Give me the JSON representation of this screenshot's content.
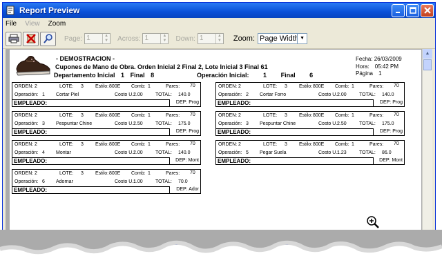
{
  "window": {
    "title": "Report Preview",
    "menu": [
      "File",
      "View",
      "Zoom"
    ]
  },
  "toolbar": {
    "page_label": "Page:",
    "page_value": "1",
    "across_label": "Across:",
    "across_value": "1",
    "down_label": "Down:",
    "down_value": "1",
    "zoom_label": "Zoom:",
    "zoom_value": "Page Width"
  },
  "report": {
    "title": "- DEMOSTRACION -",
    "line2": "Cupones de Mano de Obra.   Orden Inicial 2 Final 2, Lote Inicial 3 Final 61",
    "dept_label": "Departamento Inicial",
    "dept_from": "1",
    "dept_final_label": "Final",
    "dept_to": "8",
    "op_label": "Operación Inicial:",
    "op_from": "1",
    "op_final_label": "Final",
    "op_to": "6",
    "fecha_label": "Fecha:",
    "fecha_value": "26/03/2009",
    "hora_label": "Hora:",
    "hora_value": "05:42 PM",
    "pagina_label": "Página",
    "pagina_value": "1"
  },
  "labels": {
    "orden": "ORDEN:",
    "lote": "LOTE:",
    "estilo": "Estilo:",
    "comb": "Comb:",
    "pares": "Pares:",
    "operacion": "Operación:",
    "costo": "Costo U.:",
    "total": "TOTAL:",
    "empleado": "EMPLEADO:",
    "dep": "DEP:"
  },
  "cards": [
    {
      "orden": "2",
      "lote": "3",
      "estilo": "800E",
      "comb": "1",
      "pares": "70",
      "op": "1",
      "opname": "Cortar Piel",
      "costo": "2.00",
      "total": "140.0",
      "dep": "Prog"
    },
    {
      "orden": "2",
      "lote": "3",
      "estilo": "800E",
      "comb": "1",
      "pares": "70",
      "op": "2",
      "opname": "Cortar Forro",
      "costo": "2.00",
      "total": "140.0",
      "dep": "Prog"
    },
    {
      "orden": "2",
      "lote": "3",
      "estilo": "800E",
      "comb": "1",
      "pares": "70",
      "op": "3",
      "opname": "Pespuntar Chine",
      "costo": "2.50",
      "total": "175.0",
      "dep": "Prog"
    },
    {
      "orden": "2",
      "lote": "3",
      "estilo": "800E",
      "comb": "1",
      "pares": "70",
      "op": "3",
      "opname": "Pespuntar Chine",
      "costo": "2.50",
      "total": "175.0",
      "dep": "Prog"
    },
    {
      "orden": "2",
      "lote": "3",
      "estilo": "800E",
      "comb": "1",
      "pares": "70",
      "op": "4",
      "opname": "Montar",
      "costo": "2.00",
      "total": "140.0",
      "dep": "Mont"
    },
    {
      "orden": "2",
      "lote": "3",
      "estilo": "800E",
      "comb": "1",
      "pares": "70",
      "op": "5",
      "opname": "Pegar Suela",
      "costo": "1.23",
      "total": "86.0",
      "dep": "Mont"
    },
    {
      "orden": "2",
      "lote": "3",
      "estilo": "800E",
      "comb": "1",
      "pares": "70",
      "op": "6",
      "opname": "Adornar",
      "costo": "1.00",
      "total": "70.0",
      "dep": "Ador"
    }
  ]
}
